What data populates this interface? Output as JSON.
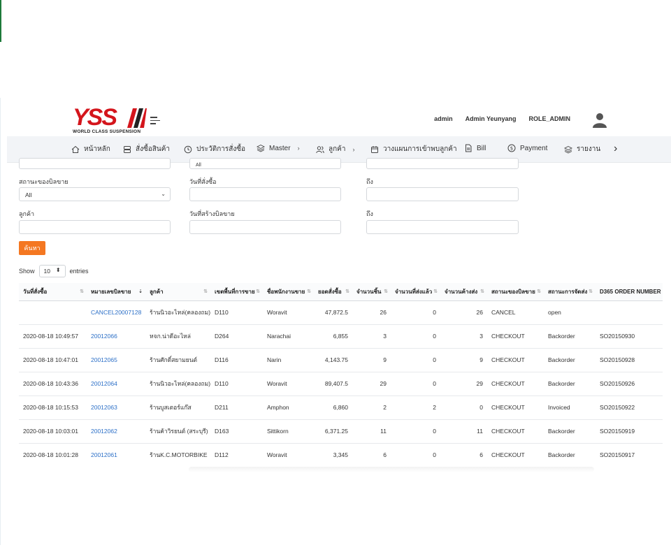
{
  "brand": {
    "logo_text": "YSS",
    "logo_sub": "WORLD CLASS SUSPENSION",
    "logo_color": "#d4151c"
  },
  "user": {
    "username": "admin",
    "fullname": "Admin Yeunyang",
    "role": "ROLE_ADMIN"
  },
  "nav": {
    "items": [
      {
        "label": "หน้าหลัก",
        "icon": "home-icon"
      },
      {
        "label": "สั่งซื้อสินค้า",
        "icon": "server-icon"
      },
      {
        "label": "ประวัติการสั่งซื้อ",
        "icon": "clock-icon"
      },
      {
        "label": "Master",
        "icon": "layers-icon"
      },
      {
        "label": "ลูกค้า",
        "icon": "users-icon"
      },
      {
        "label": "วางแผนการเข้าพบลูกค้า",
        "icon": "calendar-icon"
      },
      {
        "label": "Bill",
        "icon": "file-icon"
      },
      {
        "label": "Payment",
        "icon": "coin-icon"
      },
      {
        "label": "รายงาน",
        "icon": "layers-icon"
      }
    ]
  },
  "filters": {
    "top_row_value": "All",
    "bill_status_label": "สถานะของบิลขาย",
    "bill_status_value": "All",
    "order_date_label": "วันที่สั่งซื้อ",
    "to_label": "ถึง",
    "customer_label": "ลูกค้า",
    "bill_created_label": "วันที่สร้างบิลขาย",
    "to_label_2": "ถึง",
    "search_button": "ค้นหา",
    "accent": "#f47721"
  },
  "entries": {
    "show_label": "Show",
    "value": "10",
    "entries_label": "entries"
  },
  "table": {
    "headers": [
      "วันที่สั่งซื้อ",
      "หมายเลขบิลขาย",
      "ลูกค้า",
      "เขตพื้นที่การขาย",
      "ชื่อพนักงานขาย",
      "ยอดสั่งซื้อ",
      "จำนวนชิ้น",
      "จำนวนที่ส่งแล้ว",
      "จำนวนค้างส่ง",
      "สถานะของบิลขาย",
      "สถานะการจัดส่ง",
      "D365 ORDER NUMBER"
    ],
    "rows": [
      [
        "",
        "CANCEL20007128",
        "ร้านนิวอะไหล่(คลองถม)",
        "D110",
        "Woravit",
        "47,872.5",
        "26",
        "0",
        "26",
        "CANCEL",
        "open",
        ""
      ],
      [
        "2020-08-18 10:49:57",
        "20012066",
        "หจก.น่าดีอะไหล่",
        "D264",
        "Narachai",
        "6,855",
        "3",
        "0",
        "3",
        "CHECKOUT",
        "Backorder",
        "SO20150930"
      ],
      [
        "2020-08-18 10:47:01",
        "20012065",
        "ร้านศักดิ์สยามยนต์",
        "D116",
        "Narin",
        "4,143.75",
        "9",
        "0",
        "9",
        "CHECKOUT",
        "Backorder",
        "SO20150928"
      ],
      [
        "2020-08-18 10:43:36",
        "20012064",
        "ร้านนิวอะไหล่(คลองถม)",
        "D110",
        "Woravit",
        "89,407.5",
        "29",
        "0",
        "29",
        "CHECKOUT",
        "Backorder",
        "SO20150926"
      ],
      [
        "2020-08-18 10:15:53",
        "20012063",
        "ร้านบูสเตอร์แก๊ส",
        "D211",
        "Amphon",
        "6,860",
        "2",
        "2",
        "0",
        "CHECKOUT",
        "Invoiced",
        "SO20150922"
      ],
      [
        "2020-08-18 10:03:01",
        "20012062",
        "ร้านค้าวิรยนต์ (สระบุรี)",
        "D163",
        "Sittikorn",
        "6,371.25",
        "11",
        "0",
        "11",
        "CHECKOUT",
        "Backorder",
        "SO20150919"
      ],
      [
        "2020-08-18 10:01:28",
        "20012061",
        "ร้านK.C.MOTORBIKE",
        "D112",
        "Woravit",
        "3,345",
        "6",
        "0",
        "6",
        "CHECKOUT",
        "Backorder",
        "SO20150917"
      ]
    ],
    "link_color": "#2b6fc7"
  }
}
